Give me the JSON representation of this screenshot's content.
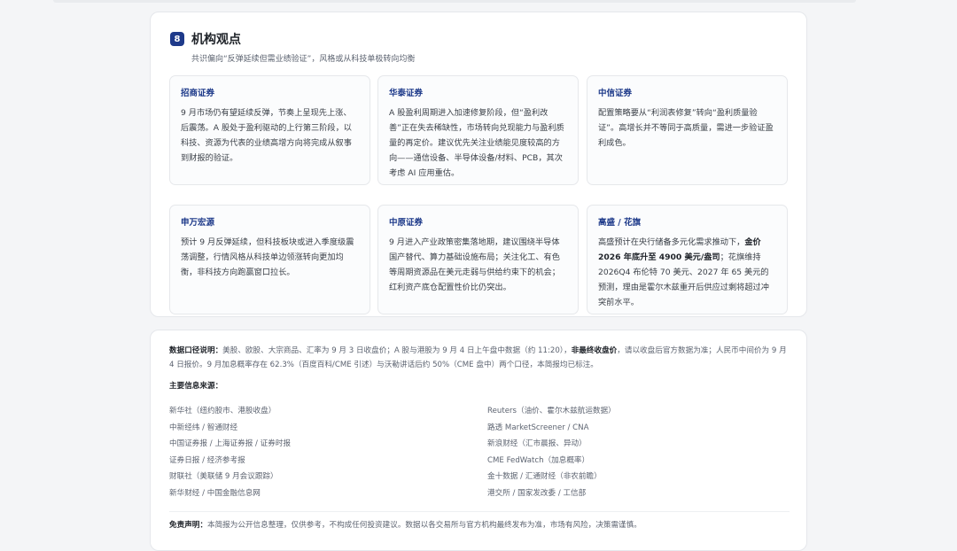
{
  "section": {
    "number": "8",
    "title": "机构观点",
    "subtitle": "共识偏向“反弹延续但需业绩验证”，风格或从科技单极转向均衡"
  },
  "institutions": [
    {
      "name": "招商证券",
      "text": "9 月市场仍有望延续反弹，节奏上呈现先上涨、后震荡。A 股处于盈利驱动的上行第三阶段，以科技、资源为代表的业绩高增方向将完成从叙事到财报的验证。"
    },
    {
      "name": "华泰证券",
      "text": "A 股盈利周期进入加速修复阶段，但“盈利改善”正在失去稀缺性，市场转向兑现能力与盈利质量的再定价。建议优先关注业绩能见度较高的方向——通信设备、半导体设备/材料、PCB，其次考虑 AI 应用重估。"
    },
    {
      "name": "中信证券",
      "text": "配置策略要从“利润表修复”转向“盈利质量验证”。高增长并不等同于高质量，需进一步验证盈利成色。"
    },
    {
      "name": "申万宏源",
      "text": "预计 9 月反弹延续，但科技板块或进入季度级震荡调整，行情风格从科技单边领涨转向更加均衡，非科技方向跑赢窗口拉长。"
    },
    {
      "name": "中原证券",
      "text": "9 月进入产业政策密集落地期，建议围绕半导体国产替代、算力基础设施布局；关注化工、有色等周期资源品在美元走弱与供给约束下的机会；红利资产底仓配置性价比仍突出。"
    },
    {
      "name": "高盛 / 花旗",
      "text_pre": "高盛预计在央行储备多元化需求推动下，",
      "text_bold": "金价 2026 年底升至 4900 美元/盎司",
      "text_post": "；花旗维持 2026Q4 布伦特 70 美元、2027 年 65 美元的预测，理由是霍尔木兹重开后供应过剩将超过冲突前水平。"
    }
  ],
  "data_note": {
    "label": "数据口径说明：",
    "pre": "美股、欧股、大宗商品、汇率为 9 月 3 日收盘价；A 股与港股为 9 月 4 日上午盘中数据（约 11:20），",
    "bold": "非最终收盘价",
    "post": "，请以收盘后官方数据为准；人民币中间价为 9 月 4 日报价。9 月加息概率存在 62.3%（百度百科/CME 引述）与沃勒讲话后约 50%（CME 盘中）两个口径，本简报均已标注。"
  },
  "sources": {
    "label": "主要信息来源：",
    "left": [
      "新华社（纽约股市、港股收盘）",
      "中新经纬 / 智通财经",
      "中国证券报 / 上海证券报 / 证券时报",
      "证券日报 / 经济参考报",
      "财联社（美联储 9 月会议跟踪）",
      "新华财经 / 中国金融信息网"
    ],
    "right": [
      "Reuters（油价、霍尔木兹航运数据）",
      "路透 MarketScreener / CNA",
      "新浪财经（汇市晨报、异动）",
      "CME FedWatch（加息概率）",
      "金十数据 / 汇通财经（非农前瞻）",
      "港交所 / 国家发改委 / 工信部"
    ]
  },
  "disclaimer": {
    "label": "免责声明：",
    "text": "本简报为公开信息整理，仅供参考，不构成任何投资建议。数据以各交易所与官方机构最终发布为准，市场有风险，决策需谨慎。"
  }
}
